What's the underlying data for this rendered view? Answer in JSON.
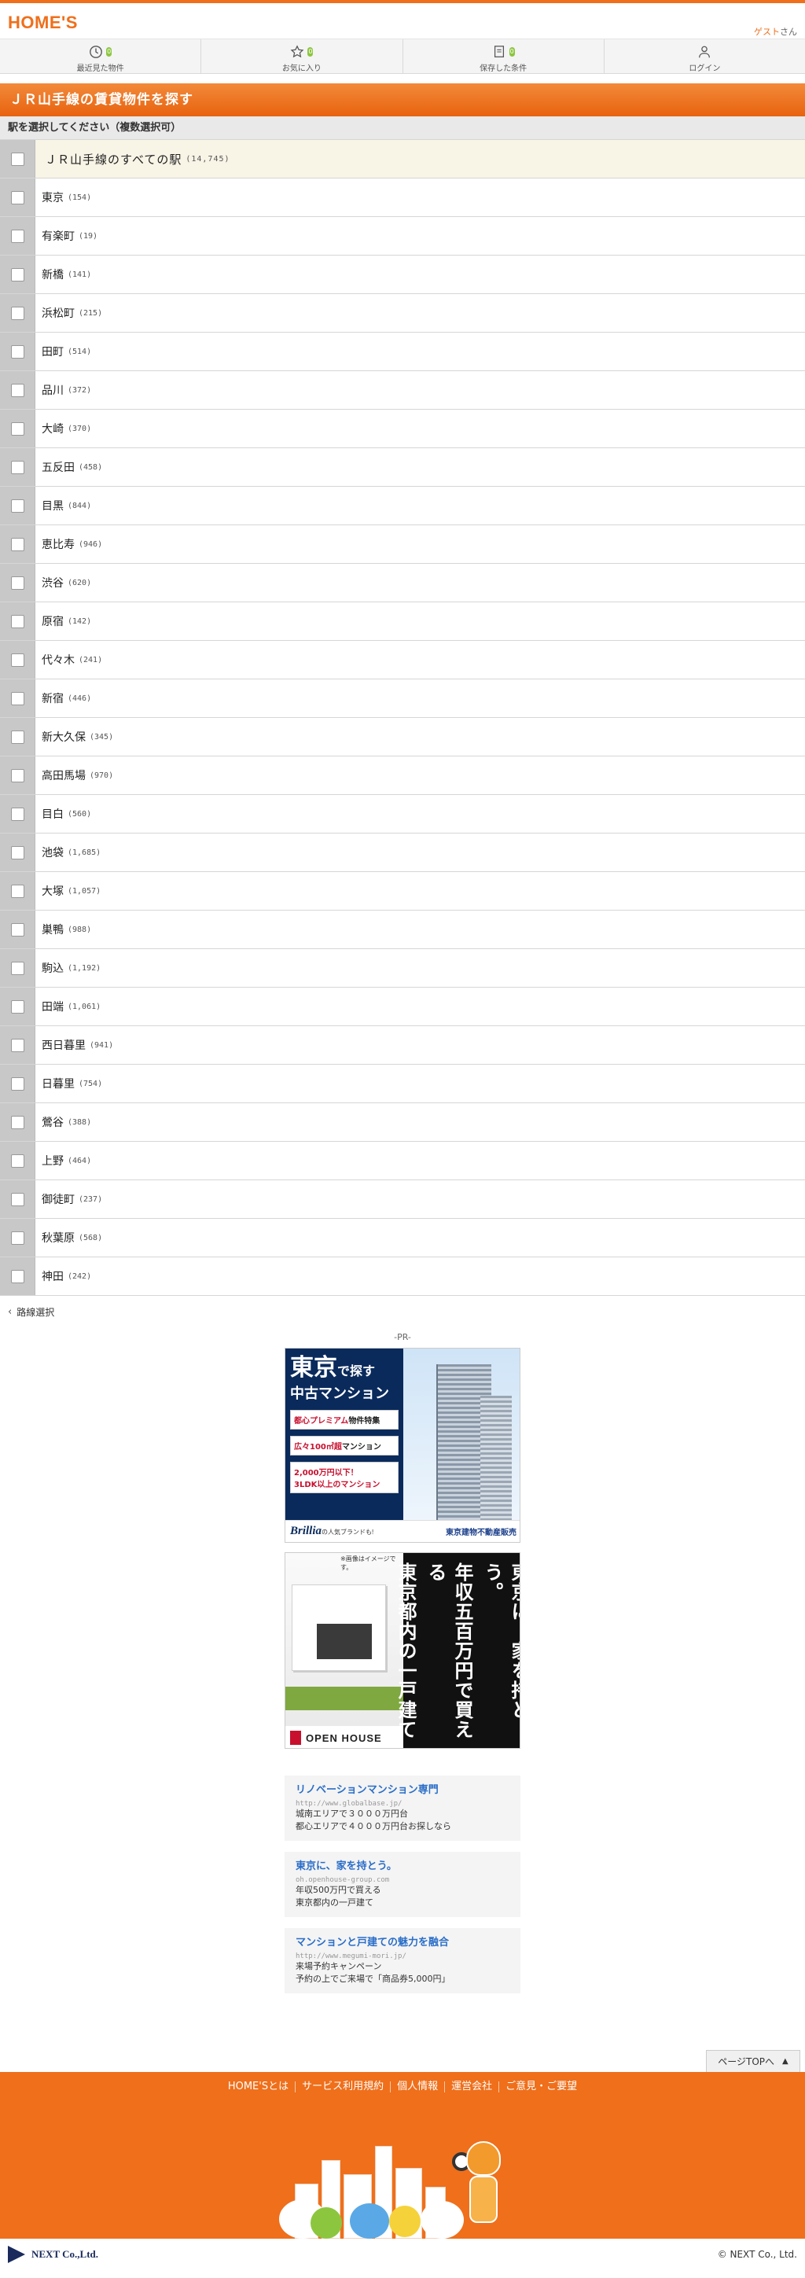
{
  "header": {
    "logo": "HOME'S",
    "guest_name": "ゲスト",
    "guest_suffix": "さん"
  },
  "nav": [
    {
      "label": "最近見た物件",
      "badge": "0",
      "icon": "clock-icon"
    },
    {
      "label": "お気に入り",
      "badge": "0",
      "icon": "star-icon"
    },
    {
      "label": "保存した条件",
      "badge": "0",
      "icon": "memo-icon"
    },
    {
      "label": "ログイン",
      "icon": "person-icon"
    }
  ],
  "page": {
    "title": "ＪＲ山手線の賃貸物件を探す",
    "instruction": "駅を選択してください（複数選択可）"
  },
  "all_stations": {
    "label": "ＪＲ山手線のすべての駅",
    "count": "(14,745)"
  },
  "stations": [
    {
      "name": "東京",
      "count": "(154)"
    },
    {
      "name": "有楽町",
      "count": "(19)"
    },
    {
      "name": "新橋",
      "count": "(141)"
    },
    {
      "name": "浜松町",
      "count": "(215)"
    },
    {
      "name": "田町",
      "count": "(514)"
    },
    {
      "name": "品川",
      "count": "(372)"
    },
    {
      "name": "大崎",
      "count": "(370)"
    },
    {
      "name": "五反田",
      "count": "(458)"
    },
    {
      "name": "目黒",
      "count": "(844)"
    },
    {
      "name": "恵比寿",
      "count": "(946)"
    },
    {
      "name": "渋谷",
      "count": "(620)"
    },
    {
      "name": "原宿",
      "count": "(142)"
    },
    {
      "name": "代々木",
      "count": "(241)"
    },
    {
      "name": "新宿",
      "count": "(446)"
    },
    {
      "name": "新大久保",
      "count": "(345)"
    },
    {
      "name": "高田馬場",
      "count": "(970)"
    },
    {
      "name": "目白",
      "count": "(560)"
    },
    {
      "name": "池袋",
      "count": "(1,685)"
    },
    {
      "name": "大塚",
      "count": "(1,057)"
    },
    {
      "name": "巣鴨",
      "count": "(988)"
    },
    {
      "name": "駒込",
      "count": "(1,192)"
    },
    {
      "name": "田端",
      "count": "(1,061)"
    },
    {
      "name": "西日暮里",
      "count": "(941)"
    },
    {
      "name": "日暮里",
      "count": "(754)"
    },
    {
      "name": "鶯谷",
      "count": "(388)"
    },
    {
      "name": "上野",
      "count": "(464)"
    },
    {
      "name": "御徒町",
      "count": "(237)"
    },
    {
      "name": "秋葉原",
      "count": "(568)"
    },
    {
      "name": "神田",
      "count": "(242)"
    }
  ],
  "back_link": "路線選択",
  "pr_label": "-PR-",
  "ad1": {
    "headline_big": "東京",
    "headline_small": "で探す",
    "headline_sub": "中古マンション",
    "box1_accent": "都心プレミアム",
    "box1_rest": "物件特集",
    "box2_accent": "広々100㎡超",
    "box2_rest": "マンション",
    "box3_line1": "2,000万円以下！",
    "box3_line2": "3LDK以上のマンション",
    "brand": "Brillia",
    "brand_tag": "の人気ブランドも!",
    "company": "東京建物不動産販売"
  },
  "ad2": {
    "note": "※画像はイメージです。",
    "copy_col1": "東京に、家を持とう。",
    "copy_col2": "年収五百万円で買える",
    "copy_col3": "東京都内の一戸建て",
    "logo": "OPEN HOUSE"
  },
  "text_ads": [
    {
      "title": "リノベーションマンション専門",
      "url": "http://www.globalbase.jp/",
      "lines": [
        "城南エリアで３０００万円台",
        "都心エリアで４０００万円台お探しなら"
      ]
    },
    {
      "title": "東京に、家を持とう。",
      "url": "oh.openhouse-group.com",
      "lines": [
        "年収500万円で買える",
        "東京都内の一戸建て"
      ]
    },
    {
      "title": "マンションと戸建ての魅力を融合",
      "url": "http://www.megumi-mori.jp/",
      "lines": [
        "来場予約キャンペーン",
        "予約の上でご来場で「商品券5,000円」"
      ]
    }
  ],
  "pagetop": "ページTOPへ",
  "footer": {
    "links": [
      "HOME'Sとは",
      "サービス利用規約",
      "個人情報",
      "運営会社",
      "ご意見・ご要望"
    ]
  },
  "bottom": {
    "company_logo": "NEXT Co.,Ltd.",
    "copyright": "© NEXT Co., Ltd."
  },
  "colors": {
    "brand_orange": "#ef6f1b",
    "link_blue": "#2a6ec8",
    "badge_green": "#8cc63f"
  }
}
